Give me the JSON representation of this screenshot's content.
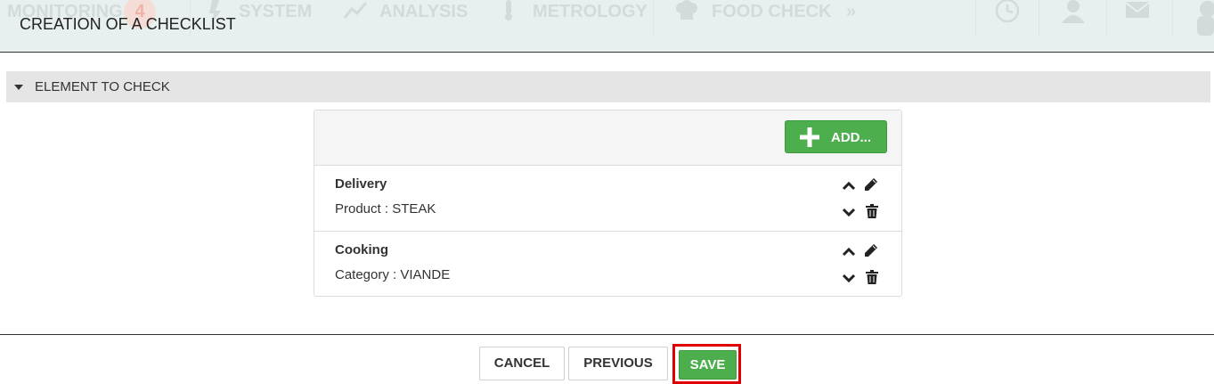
{
  "background_nav": {
    "items": [
      "MONITORING",
      "SYSTEM",
      "ANALYSIS",
      "METROLOGY",
      "FOOD CHECK"
    ],
    "badge_count": "4",
    "icons": [
      "clock-icon",
      "user-icon",
      "mail-icon",
      "chef-icon"
    ]
  },
  "dialog": {
    "title": "CREATION OF A CHECKLIST",
    "section_label": "ELEMENT TO CHECK",
    "add_label": "ADD...",
    "items": [
      {
        "name": "Delivery",
        "detail": "Product : STEAK"
      },
      {
        "name": "Cooking",
        "detail": "Category : VIANDE"
      }
    ]
  },
  "footer": {
    "cancel_label": "CANCEL",
    "previous_label": "PREVIOUS",
    "save_label": "SAVE"
  },
  "colors": {
    "accent_green": "#4cae4c",
    "highlight_red": "#e00000",
    "section_bg": "#e5e5e5"
  }
}
